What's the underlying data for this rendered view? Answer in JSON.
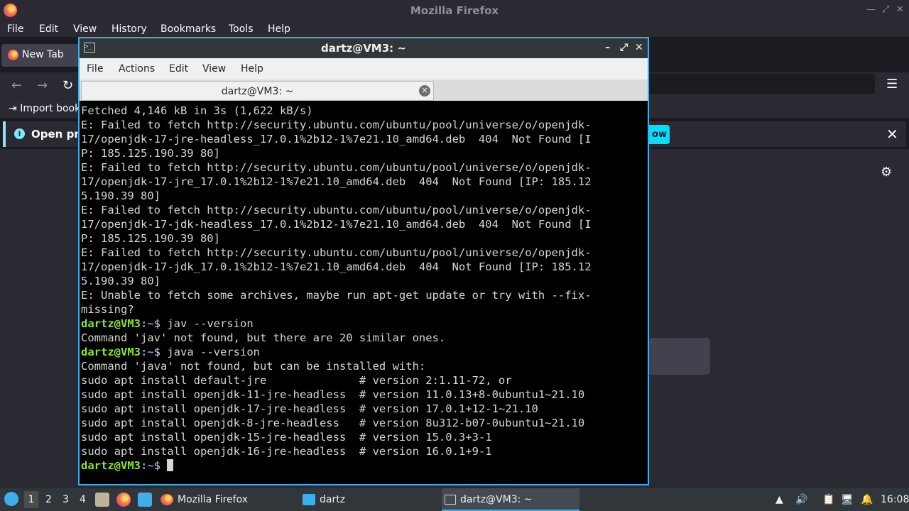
{
  "firefox": {
    "window_title": "Mozilla Firefox",
    "menu": [
      "File",
      "Edit",
      "View",
      "History",
      "Bookmarks",
      "Tools",
      "Help"
    ],
    "tab_label": "New Tab",
    "import_bookmarks": "Import book",
    "notice_text": "Open pre",
    "notice_button": "ow",
    "close_glyph": "✕",
    "hamburger_glyph": "☰",
    "gear_glyph": "⚙"
  },
  "terminal": {
    "window_title": "dartz@VM3: ~",
    "menu": [
      "File",
      "Actions",
      "Edit",
      "View",
      "Help"
    ],
    "tab_label": "dartz@VM3: ~",
    "prompt_user": "dartz@VM3",
    "prompt_path": ":~",
    "prompt_symbol": "$ ",
    "lines": [
      {
        "t": "Fetched 4,146 kB in 3s (1,622 kB/s)"
      },
      {
        "t": "E: Failed to fetch http://security.ubuntu.com/ubuntu/pool/universe/o/openjdk-"
      },
      {
        "t": "17/openjdk-17-jre-headless_17.0.1%2b12-1%7e21.10_amd64.deb  404  Not Found [I"
      },
      {
        "t": "P: 185.125.190.39 80]"
      },
      {
        "t": "E: Failed to fetch http://security.ubuntu.com/ubuntu/pool/universe/o/openjdk-"
      },
      {
        "t": "17/openjdk-17-jre_17.0.1%2b12-1%7e21.10_amd64.deb  404  Not Found [IP: 185.12"
      },
      {
        "t": "5.190.39 80]"
      },
      {
        "t": "E: Failed to fetch http://security.ubuntu.com/ubuntu/pool/universe/o/openjdk-"
      },
      {
        "t": "17/openjdk-17-jdk-headless_17.0.1%2b12-1%7e21.10_amd64.deb  404  Not Found [I"
      },
      {
        "t": "P: 185.125.190.39 80]"
      },
      {
        "t": "E: Failed to fetch http://security.ubuntu.com/ubuntu/pool/universe/o/openjdk-"
      },
      {
        "t": "17/openjdk-17-jdk_17.0.1%2b12-1%7e21.10_amd64.deb  404  Not Found [IP: 185.12"
      },
      {
        "t": "5.190.39 80]"
      },
      {
        "t": "E: Unable to fetch some archives, maybe run apt-get update or try with --fix-"
      },
      {
        "t": "missing?"
      },
      {
        "cmd": "jav --version"
      },
      {
        "t": "Command 'jav' not found, but there are 20 similar ones."
      },
      {
        "cmd": "java --version"
      },
      {
        "t": "Command 'java' not found, but can be installed with:"
      },
      {
        "t": "sudo apt install default-jre              # version 2:1.11-72, or"
      },
      {
        "t": "sudo apt install openjdk-11-jre-headless  # version 11.0.13+8-0ubuntu1~21.10"
      },
      {
        "t": "sudo apt install openjdk-17-jre-headless  # version 17.0.1+12-1~21.10"
      },
      {
        "t": "sudo apt install openjdk-8-jre-headless   # version 8u312-b07-0ubuntu1~21.10"
      },
      {
        "t": "sudo apt install openjdk-15-jre-headless  # version 15.0.3+3-1"
      },
      {
        "t": "sudo apt install openjdk-16-jre-headless  # version 16.0.1+9-1"
      },
      {
        "cmd": "",
        "cursor": true
      }
    ]
  },
  "taskbar": {
    "workspaces": [
      "1",
      "2",
      "3",
      "4"
    ],
    "tasks": [
      "Mozilla Firefox",
      "dartz",
      "dartz@VM3: ~"
    ],
    "clock": "16:08"
  }
}
